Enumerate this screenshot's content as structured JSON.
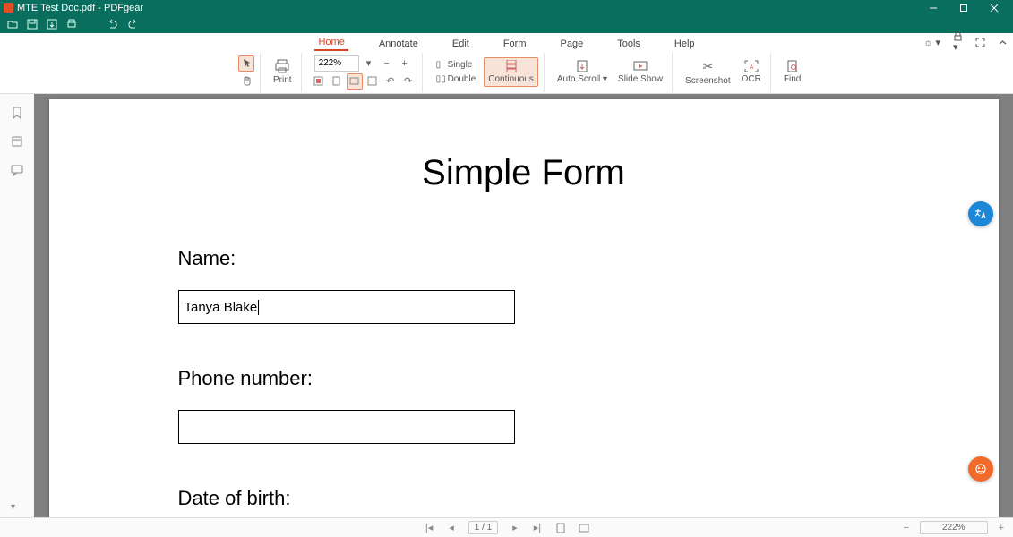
{
  "window": {
    "title": "MTE Test Doc.pdf - PDFgear"
  },
  "menu": {
    "items": [
      "Home",
      "Annotate",
      "Edit",
      "Form",
      "Page",
      "Tools",
      "Help"
    ],
    "active_index": 0
  },
  "ribbon": {
    "print": "Print",
    "zoom_value": "222%",
    "scroll_mode": {
      "single": "Single",
      "double": "Double",
      "continuous": "Continuous",
      "active": "continuous"
    },
    "auto_scroll": "Auto Scroll",
    "slide_show": "Slide Show",
    "screenshot": "Screenshot",
    "ocr": "OCR",
    "find": "Find"
  },
  "document": {
    "title": "Simple Form",
    "fields": {
      "name_label": "Name:",
      "name_value": "Tanya Blake",
      "phone_label": "Phone number:",
      "phone_value": "",
      "dob_label": "Date of birth:"
    }
  },
  "status": {
    "page_current": "1",
    "page_total": "1",
    "zoom": "222%"
  }
}
